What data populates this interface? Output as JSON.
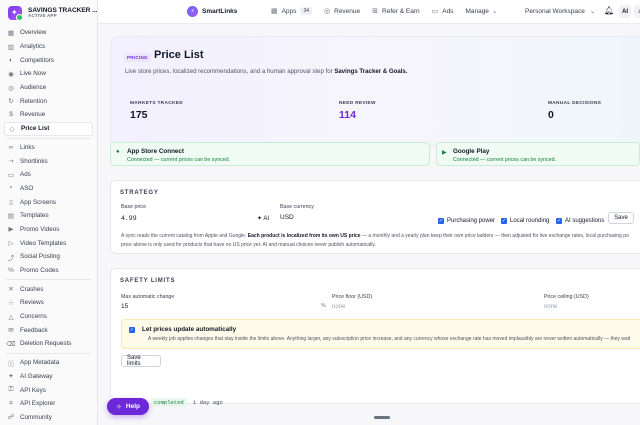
{
  "app": {
    "name": "SAVINGS TRACKER ...",
    "status": "ACTIVE APP"
  },
  "sidebar": {
    "group1": [
      {
        "label": "Overview",
        "icon": "grid-icon"
      },
      {
        "label": "Analytics",
        "icon": "chart-icon"
      },
      {
        "label": "Competitors",
        "icon": "users-icon"
      },
      {
        "label": "Live Now",
        "icon": "pulse-icon"
      },
      {
        "label": "Audience",
        "icon": "audience-icon"
      },
      {
        "label": "Retention",
        "icon": "retention-icon"
      },
      {
        "label": "Revenue",
        "icon": "dollar-icon"
      },
      {
        "label": "Price List",
        "icon": "tag-icon"
      }
    ],
    "group2": [
      {
        "label": "Links",
        "icon": "link-icon"
      },
      {
        "label": "Shortlinks",
        "icon": "shortlink-icon"
      },
      {
        "label": "Ads",
        "icon": "ads-icon"
      },
      {
        "label": "ASO",
        "icon": "search-icon"
      },
      {
        "label": "App Screens",
        "icon": "screens-icon"
      },
      {
        "label": "Templates",
        "icon": "template-icon"
      },
      {
        "label": "Promo Videos",
        "icon": "video-icon"
      },
      {
        "label": "Video Templates",
        "icon": "video-template-icon"
      },
      {
        "label": "Social Posting",
        "icon": "share-icon"
      },
      {
        "label": "Promo Codes",
        "icon": "code-icon"
      }
    ],
    "group3": [
      {
        "label": "Crashes",
        "icon": "crash-icon"
      },
      {
        "label": "Reviews",
        "icon": "star-icon"
      },
      {
        "label": "Concerns",
        "icon": "alert-icon"
      },
      {
        "label": "Feedback",
        "icon": "feedback-icon"
      },
      {
        "label": "Deletion Requests",
        "icon": "trash-icon"
      }
    ],
    "group4": [
      {
        "label": "App Metadata",
        "icon": "info-icon"
      },
      {
        "label": "AI Gateway",
        "icon": "ai-icon"
      },
      {
        "label": "API Keys",
        "icon": "key-icon"
      },
      {
        "label": "API Explorer",
        "icon": "explorer-icon"
      },
      {
        "label": "Community",
        "icon": "community-icon"
      }
    ]
  },
  "topbar": {
    "brand": "SmartLinks",
    "apps_label": "Apps",
    "apps_count": "34",
    "revenue_label": "Revenue",
    "refer_label": "Refer & Earn",
    "ads_label": "Ads",
    "manage_label": "Manage",
    "workspace": "Personal Workspace",
    "ai_label": "AI",
    "avatar_label": "a"
  },
  "hero": {
    "pill": "PRICING",
    "title": "Price List",
    "desc_pre": "Live store prices, localized recommendations, and a human approval step for ",
    "desc_app": "Savings Tracker & Goals.",
    "export_label": "Ex",
    "stats": [
      {
        "label": "MARKETS TRACKED",
        "value": "175"
      },
      {
        "label": "NEED REVIEW",
        "value": "114"
      },
      {
        "label": "MANUAL DECISIONS",
        "value": "0"
      }
    ]
  },
  "connections": [
    {
      "title": "App Store Connect",
      "status": "Connected — current prices can be synced."
    },
    {
      "title": "Google Play",
      "status": "Connected — current prices can be synced."
    }
  ],
  "strategy": {
    "title": "STRATEGY",
    "base_price_label": "Base price",
    "base_price_value": "4.99",
    "ai_label": "AI",
    "base_currency_label": "Base currency",
    "base_currency_value": "USD",
    "options": [
      "Purchasing power",
      "Local rounding",
      "AI suggestions"
    ],
    "save_label": "Save",
    "note_pre": "A sync reads the current catalog from Apple and Google. ",
    "note_bold": "Each product is localized from its own US price",
    "note_post": " — a monthly and a yearly plan keep their own price ladders — then adjusted for live exchange rates, local purchasing po",
    "note_line2": "price above is only used for products that have no US price yet. AI and manual choices never publish automatically."
  },
  "safety": {
    "title": "SAFETY LIMITS",
    "max_change_label": "Max automatic change",
    "max_change_value": "15",
    "percent": "%",
    "floor_label": "Price floor (USD)",
    "floor_placeholder": "none",
    "ceiling_label": "Price ceiling (USD)",
    "ceiling_placeholder": "none",
    "auto_title": "Let prices update automatically",
    "auto_desc": "A weekly job applies changes that stay inside the limits above. Anything larger, any subscription price increase, and any currency whose exchange rate has moved implausibly are never written automatically — they wait",
    "save_limits_label": "Save limits"
  },
  "log": {
    "status": "completed",
    "time": "1 day ago"
  },
  "help": {
    "label": "Help"
  }
}
